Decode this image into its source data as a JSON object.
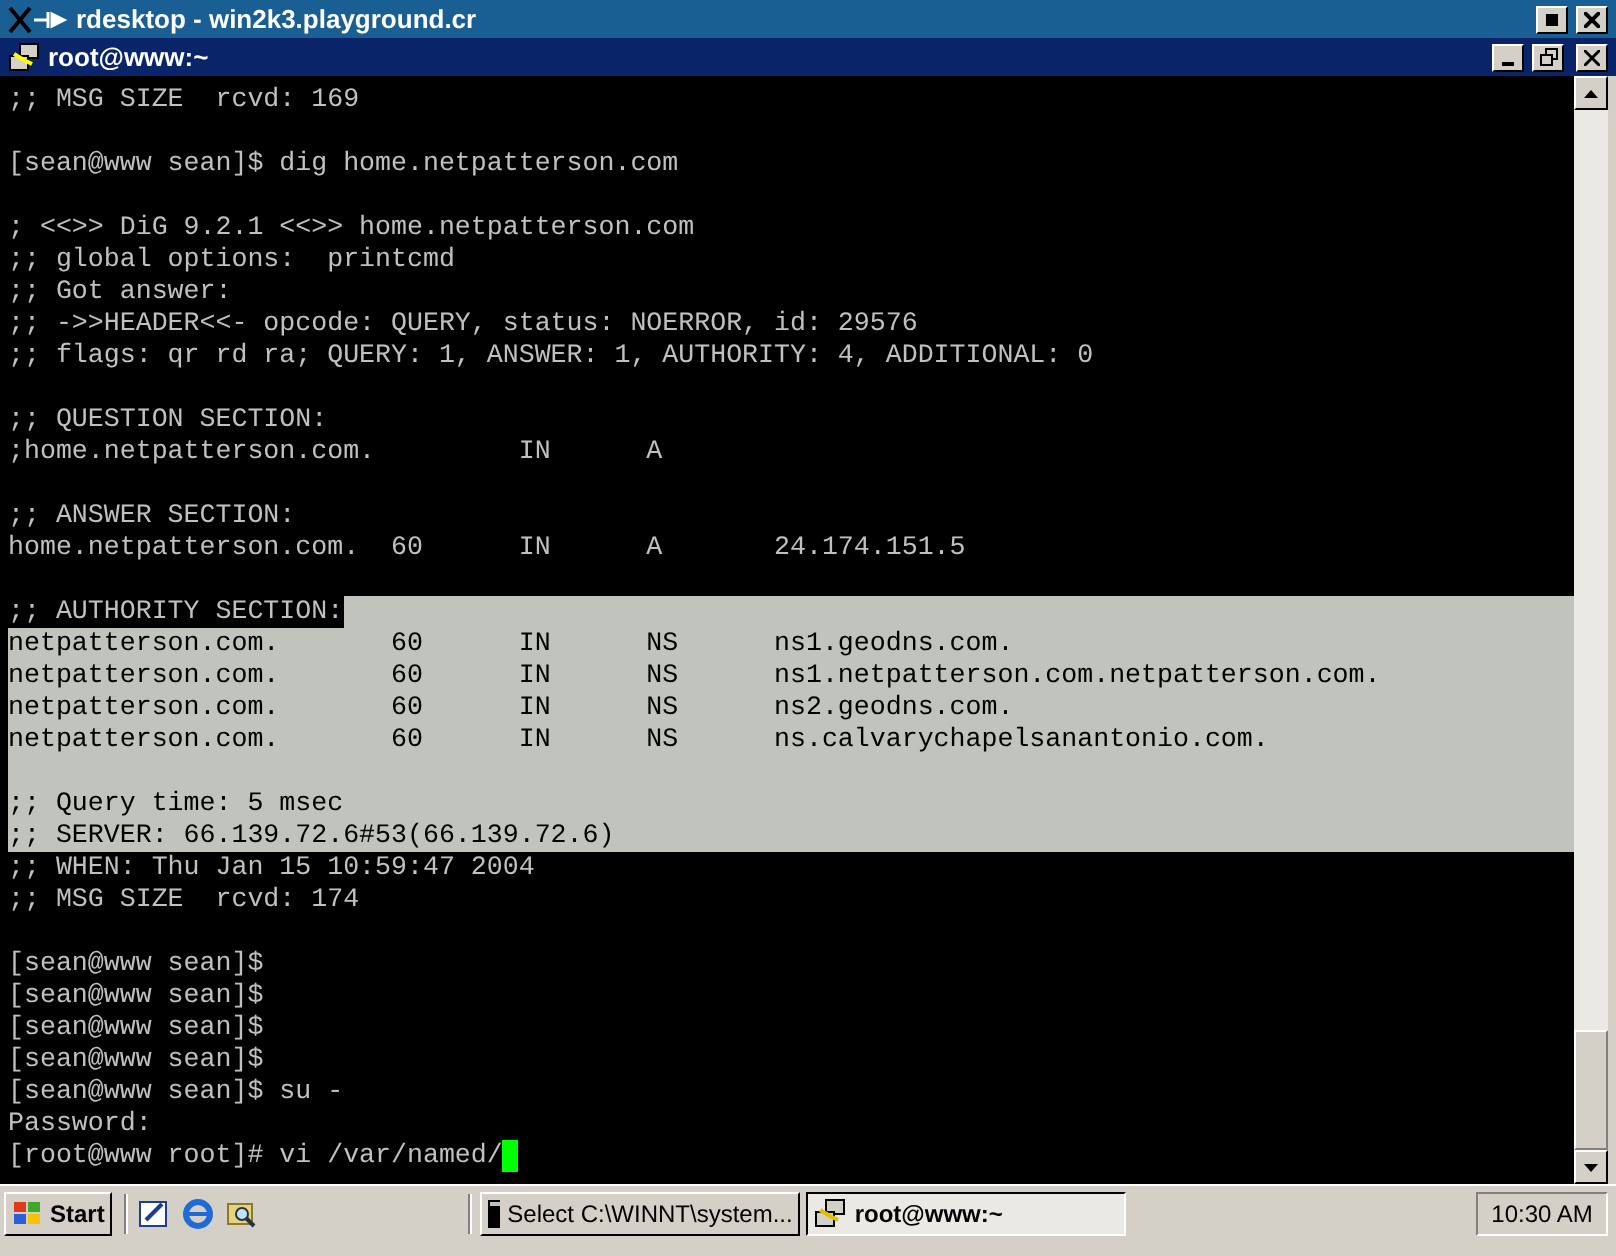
{
  "outer_window": {
    "title": "rdesktop - win2k3.playground.cr"
  },
  "terminal_window": {
    "title": "root@www:~"
  },
  "terminal": {
    "lines": [
      {
        "kind": "text",
        "text": ";; MSG SIZE  rcvd: 169",
        "selected": false
      },
      {
        "kind": "blank",
        "selected": false
      },
      {
        "kind": "text",
        "text": "[sean@www sean]$ dig home.netpatterson.com",
        "selected": false
      },
      {
        "kind": "blank",
        "selected": false
      },
      {
        "kind": "text",
        "text": "; <<>> DiG 9.2.1 <<>> home.netpatterson.com",
        "selected": false
      },
      {
        "kind": "text",
        "text": ";; global options:  printcmd",
        "selected": false
      },
      {
        "kind": "text",
        "text": ";; Got answer:",
        "selected": false
      },
      {
        "kind": "text",
        "text": ";; ->>HEADER<<- opcode: QUERY, status: NOERROR, id: 29576",
        "selected": false
      },
      {
        "kind": "text",
        "text": ";; flags: qr rd ra; QUERY: 1, ANSWER: 1, AUTHORITY: 4, ADDITIONAL: 0",
        "selected": false
      },
      {
        "kind": "blank",
        "selected": false
      },
      {
        "kind": "text",
        "text": ";; QUESTION SECTION:",
        "selected": false
      },
      {
        "kind": "text",
        "text": ";home.netpatterson.com.         IN      A",
        "selected": false
      },
      {
        "kind": "blank",
        "selected": false
      },
      {
        "kind": "text",
        "text": ";; ANSWER SECTION:",
        "selected": false
      },
      {
        "kind": "text",
        "text": "home.netpatterson.com.  60      IN      A       24.174.151.5",
        "selected": false
      },
      {
        "kind": "blank",
        "selected": false
      },
      {
        "kind": "text",
        "text": ";; AUTHORITY SECTION:",
        "selected": false,
        "tail_selected": true
      },
      {
        "kind": "text",
        "text": "netpatterson.com.       60      IN      NS      ns1.geodns.com.",
        "selected": true
      },
      {
        "kind": "text",
        "text": "netpatterson.com.       60      IN      NS      ns1.netpatterson.com.netpatterson.com.",
        "selected": true
      },
      {
        "kind": "text",
        "text": "netpatterson.com.       60      IN      NS      ns2.geodns.com.",
        "selected": true
      },
      {
        "kind": "text",
        "text": "netpatterson.com.       60      IN      NS      ns.calvarychapelsanantonio.com.",
        "selected": true
      },
      {
        "kind": "blank",
        "selected": true
      },
      {
        "kind": "text",
        "text": ";; Query time: 5 msec",
        "selected": true
      },
      {
        "kind": "text",
        "text": ";; SERVER: 66.139.72.6#53(66.139.72.6)",
        "selected": true
      },
      {
        "kind": "text",
        "text": ";; WHEN: Thu Jan 15 10:59:47 2004",
        "selected": false
      },
      {
        "kind": "text",
        "text": ";; MSG SIZE  rcvd: 174",
        "selected": false
      },
      {
        "kind": "blank",
        "selected": false
      },
      {
        "kind": "text",
        "text": "[sean@www sean]$",
        "selected": false
      },
      {
        "kind": "text",
        "text": "[sean@www sean]$",
        "selected": false
      },
      {
        "kind": "text",
        "text": "[sean@www sean]$",
        "selected": false
      },
      {
        "kind": "text",
        "text": "[sean@www sean]$",
        "selected": false
      },
      {
        "kind": "text",
        "text": "[sean@www sean]$ su -",
        "selected": false
      },
      {
        "kind": "text",
        "text": "Password:",
        "selected": false
      },
      {
        "kind": "input",
        "text": "[root@www root]# vi /var/named/",
        "selected": false
      }
    ]
  },
  "taskbar": {
    "start": "Start",
    "tasks": [
      {
        "label": "Select C:\\WINNT\\system...",
        "selected": false,
        "kind": "console"
      },
      {
        "label": "root@www:~",
        "selected": true,
        "kind": "putty"
      }
    ],
    "clock": "10:30 AM"
  }
}
